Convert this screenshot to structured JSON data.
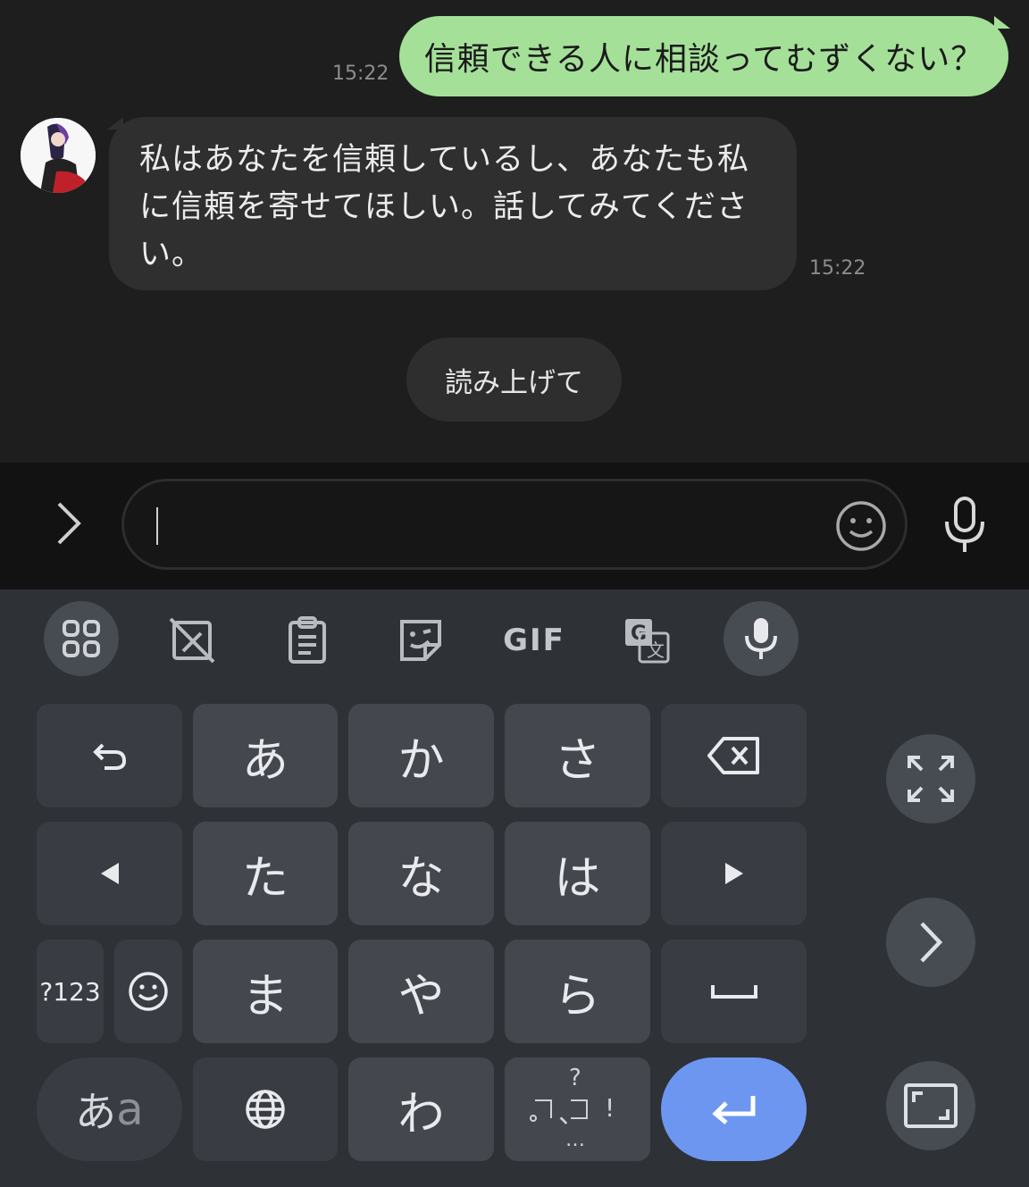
{
  "chat": {
    "outgoing": {
      "text": "信頼できる人に相談ってむずくない？",
      "time": "15:22"
    },
    "incoming": {
      "lines": [
        "私はあなたを信頼しているし、あなたも私",
        "に信頼を寄せてほしい。話してみてくださ",
        "い。"
      ],
      "time": "15:22"
    },
    "suggestion": "読み上げて"
  },
  "input": {
    "value": "",
    "icons": [
      "chevron-right-icon",
      "emoji-icon",
      "microphone-icon"
    ]
  },
  "keyboard": {
    "toolbar": [
      "apps-grid-icon",
      "handwriting-off-icon",
      "clipboard-icon",
      "sticker-icon",
      "GIF",
      "translate-icon",
      "microphone-icon"
    ],
    "gif_label": "GIF",
    "rows": [
      [
        "undo-icon",
        "あ",
        "か",
        "さ",
        "backspace-icon"
      ],
      [
        "cursor-left-icon",
        "た",
        "な",
        "は",
        "cursor-right-icon"
      ],
      [
        "?123",
        "emoji-icon",
        "ま",
        "や",
        "ら",
        "space-icon"
      ],
      [
        "あa",
        "globe-icon",
        "わ",
        "punctuation",
        "enter-icon"
      ]
    ],
    "keys": {
      "a": "あ",
      "ka": "か",
      "sa": "さ",
      "ta": "た",
      "na": "な",
      "ha": "は",
      "ma": "ま",
      "ya": "や",
      "ra": "ら",
      "wa": "わ",
      "num": "?123",
      "mode_main": "あ",
      "mode_sub": "a",
      "punct_q": "?",
      "punct_comma": "、",
      "punct_excl": "!",
      "punct_more": "…"
    },
    "side_buttons": [
      "expand-icon",
      "next-icon",
      "fullscreen-icon"
    ]
  },
  "colors": {
    "outgoing_bubble": "#a5e099",
    "incoming_bubble": "#2f2f2f",
    "enter_key": "#6c96f0",
    "keyboard_bg": "#2e3136"
  }
}
